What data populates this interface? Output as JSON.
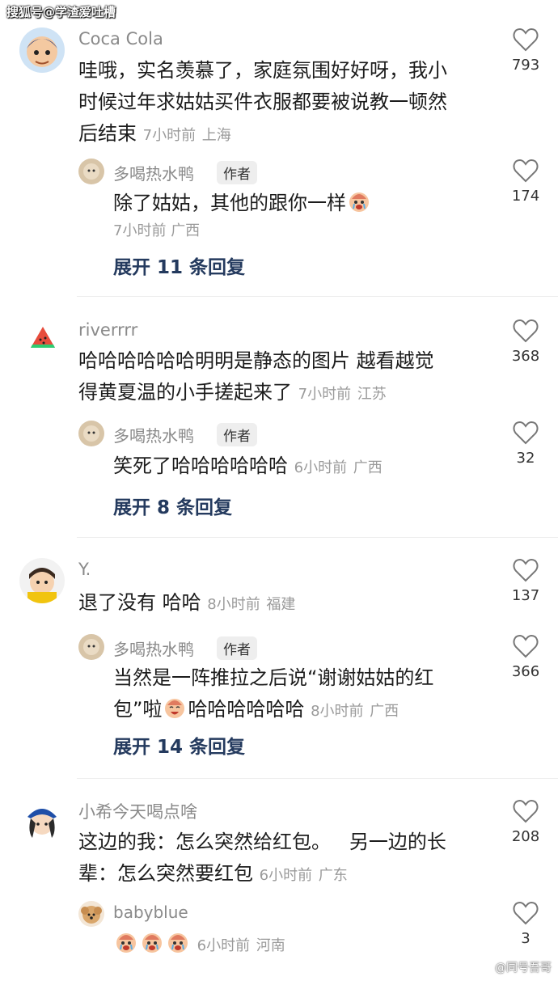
{
  "watermarks": {
    "top": "搜狐号@学渣爱吐槽",
    "bottom": "@同号吾哥"
  },
  "comments": [
    {
      "username": "Coca Cola",
      "text_line1": "哇哦，实名羡慕了，家庭氛围好好呀，我小",
      "text_line2": "时候过年求姑姑买件衣服都要被说教一顿然",
      "text_line3": "后结束",
      "time": "7小时前",
      "location": "上海",
      "likes": "793",
      "reply": {
        "username": "多喝热水鸭",
        "badge": "作者",
        "text": "除了姑姑，其他的跟你一样",
        "time": "7小时前",
        "location": "广西",
        "likes": "174"
      },
      "expand_label": "展开 11 条回复"
    },
    {
      "username": "riverrrr",
      "text_line1": "哈哈哈哈哈哈明明是静态的图片 越看越觉",
      "text_line2": "得黄夏温的小手搓起来了",
      "time": "7小时前",
      "location": "江苏",
      "likes": "368",
      "reply": {
        "username": "多喝热水鸭",
        "badge": "作者",
        "text": "笑死了哈哈哈哈哈哈",
        "time": "6小时前",
        "location": "广西",
        "likes": "32"
      },
      "expand_label": "展开 8 条回复"
    },
    {
      "username": "Y.",
      "text_line1": "退了没有 哈哈",
      "time": "8小时前",
      "location": "福建",
      "likes": "137",
      "reply": {
        "username": "多喝热水鸭",
        "badge": "作者",
        "text_line1": "当然是一阵推拉之后说“谢谢姑姑的红",
        "text_line2a": "包”啦",
        "text_line2b": "哈哈哈哈哈哈",
        "time": "8小时前",
        "location": "广西",
        "likes": "366"
      },
      "expand_label": "展开 14 条回复"
    },
    {
      "username": "小希今天喝点啥",
      "text_line1": "这边的我：怎么突然给红包。   另一边的长",
      "text_line2": "辈：怎么突然要红包",
      "time": "6小时前",
      "location": "广东",
      "likes": "208",
      "reply": {
        "username": "babyblue",
        "time": "6小时前",
        "location": "河南",
        "likes": "3"
      }
    }
  ],
  "colors": {
    "expand_link": "#243a5e",
    "meta_gray": "#9a9a9a",
    "username_gray": "#8a8a8a"
  }
}
